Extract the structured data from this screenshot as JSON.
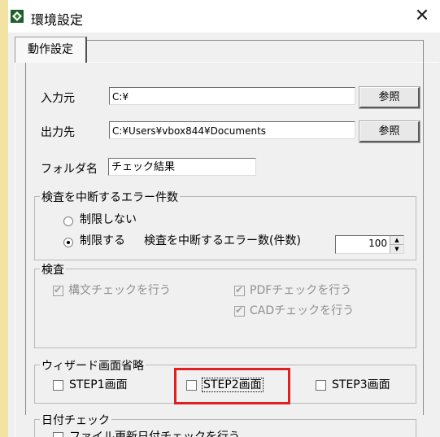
{
  "window": {
    "title": "環境設定",
    "close_glyph": "✕"
  },
  "tabs": [
    {
      "label": "動作設定"
    }
  ],
  "input_source": {
    "label": "入力元",
    "value": "C:¥",
    "browse_label": "参照"
  },
  "output_dest": {
    "label": "出力先",
    "value": "C:¥Users¥vbox844¥Documents",
    "browse_label": "参照"
  },
  "folder_name": {
    "label": "フォルダ名",
    "value": "チェック結果"
  },
  "error_group": {
    "title": "検査を中断するエラー件数",
    "options": [
      {
        "label": "制限しない",
        "checked": false
      },
      {
        "label": "制限する",
        "checked": true
      }
    ],
    "count_label": "検査を中断するエラー数(件数)",
    "count_value": "100"
  },
  "inspection_group": {
    "title": "検査",
    "checks": [
      {
        "label": "構文チェックを行う",
        "checked": true,
        "enabled": false
      },
      {
        "label": "PDFチェックを行う",
        "checked": true,
        "enabled": false
      },
      {
        "label": "CADチェックを行う",
        "checked": true,
        "enabled": false
      }
    ]
  },
  "wizard_group": {
    "title": "ウィザード画面省略",
    "checks": [
      {
        "label": "STEP1画面",
        "checked": false
      },
      {
        "label": "STEP2画面",
        "checked": false,
        "focused": true
      },
      {
        "label": "STEP3画面",
        "checked": false
      }
    ]
  },
  "date_group": {
    "title": "日付チェック",
    "checks": [
      {
        "label": "ファイル更新日付チェックを行う",
        "checked": false
      }
    ]
  },
  "colors": {
    "highlight": "#e02020",
    "icon_green": "#2e7d32"
  },
  "icons": {
    "app": "settings-diamond-icon",
    "close": "close-icon"
  }
}
